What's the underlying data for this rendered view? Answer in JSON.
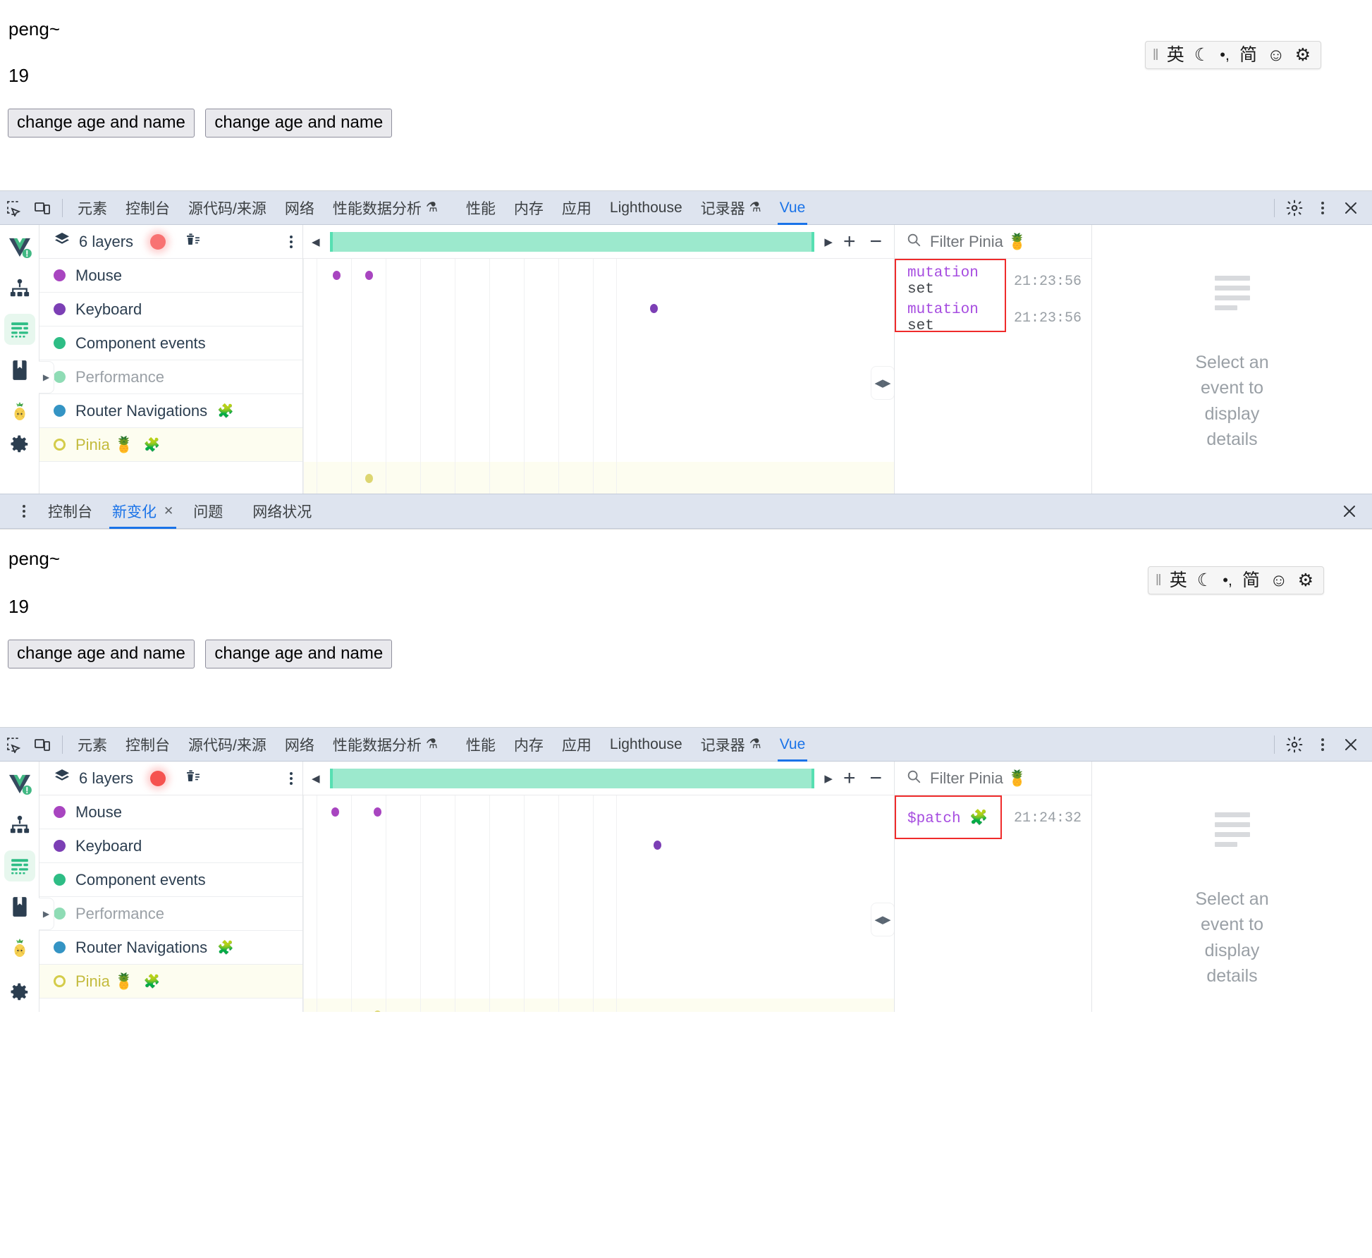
{
  "app": {
    "name_text": "peng~",
    "age_text": "19",
    "button1_label": "change age and name",
    "button2_label": "change age and name"
  },
  "ime_bar": {
    "grip": "ime-grip-icon",
    "items": [
      {
        "icon": "english-mode-icon",
        "glyph": "英"
      },
      {
        "icon": "moon-icon",
        "glyph": "☾"
      },
      {
        "icon": "punctuation-icon",
        "glyph": "•,"
      },
      {
        "icon": "simplified-chinese-icon",
        "glyph": "简"
      },
      {
        "icon": "emoji-icon",
        "glyph": "☺"
      },
      {
        "icon": "gear-icon",
        "glyph": "⚙"
      }
    ]
  },
  "devtools": {
    "left_icons": [
      {
        "name": "inspect-element-icon",
        "glyph": "⊹"
      },
      {
        "name": "device-toolbar-icon",
        "glyph": "▭"
      }
    ],
    "tabs": [
      {
        "label": "元素",
        "flask": false,
        "active": false
      },
      {
        "label": "控制台",
        "flask": false,
        "active": false
      },
      {
        "label": "源代码/来源",
        "flask": false,
        "active": false
      },
      {
        "label": "网络",
        "flask": false,
        "active": false
      },
      {
        "label": "性能数据分析",
        "flask": true,
        "active": false
      },
      {
        "label": "性能",
        "flask": false,
        "active": false
      },
      {
        "label": "内存",
        "flask": false,
        "active": false
      },
      {
        "label": "应用",
        "flask": false,
        "active": false
      },
      {
        "label": "Lighthouse",
        "flask": false,
        "active": false
      },
      {
        "label": "记录器",
        "flask": true,
        "active": false
      },
      {
        "label": "Vue",
        "flask": false,
        "active": true
      }
    ],
    "right_icons": [
      {
        "name": "settings-gear-icon",
        "glyph": "⚙"
      },
      {
        "name": "more-options-icon",
        "glyph": "⋮"
      },
      {
        "name": "close-devtools-icon",
        "glyph": "✕"
      }
    ],
    "flask_glyph": "⚗",
    "accent_color": "#1a73e8",
    "tabbar_bg": "#dee4ef"
  },
  "vue_panel": {
    "rail_items": [
      {
        "name": "vue-logo-icon",
        "active": false
      },
      {
        "name": "component-tree-icon",
        "active": false
      },
      {
        "name": "timeline-icon",
        "active": true
      },
      {
        "name": "docs-book-icon",
        "active": false
      },
      {
        "name": "pinia-pineapple-icon",
        "active": false
      }
    ],
    "rail_bottom": {
      "name": "settings-gear-icon"
    },
    "layers_header": {
      "layers_icon": "layers-icon",
      "layers_label": "6 layers",
      "record_button": "record-toggle-button",
      "clear_button": "clear-timeline-icon",
      "menu_button": "more-options-icon",
      "record_color": "#f87272"
    },
    "layers": [
      {
        "label": "Mouse",
        "color": "#a845c0",
        "hollow": false,
        "dim": false,
        "plugin": false
      },
      {
        "label": "Keyboard",
        "color": "#7c3fb5",
        "hollow": false,
        "dim": false,
        "plugin": false
      },
      {
        "label": "Component events",
        "color": "#2ebd85",
        "hollow": false,
        "dim": false,
        "plugin": false
      },
      {
        "label": "Performance",
        "color": "#8fdcb5",
        "hollow": false,
        "dim": true,
        "plugin": false
      },
      {
        "label": "Router Navigations",
        "color": "#3494c4",
        "hollow": false,
        "dim": false,
        "plugin": true
      },
      {
        "label": "Pinia 🍍",
        "color": "#d4cc4a",
        "hollow": true,
        "dim": false,
        "plugin": true
      }
    ],
    "timeline": {
      "scroll_left_icon": "scroll-left-icon",
      "scroll_right_icon": "scroll-right-icon",
      "zoom_in_label": "+",
      "zoom_out_label": "−",
      "selection_color": "#9ce9cd",
      "grid_count": 11,
      "handle_icon": "resize-handle-icon"
    },
    "search": {
      "icon": "search-icon",
      "placeholder": "Filter Pinia 🍍"
    },
    "detail_placeholder": {
      "icon": "empty-list-icon",
      "text": "Select an event to display details"
    }
  },
  "panel_one": {
    "events": [
      {
        "keyword": "mutation",
        "rest": " set",
        "time": "21:23:56"
      },
      {
        "keyword": "mutation",
        "rest": " set",
        "time": "21:23:56"
      }
    ],
    "annotation_color": "#ef2b2b"
  },
  "panel_two": {
    "events": [
      {
        "keyword": "$patch",
        "rest": " 🧩",
        "time": "21:24:32"
      }
    ],
    "annotation_color": "#ef2b2b"
  },
  "drawer": {
    "menu_icon": "more-options-icon",
    "tabs": [
      {
        "label": "控制台",
        "active": false,
        "closable": false
      },
      {
        "label": "新变化",
        "active": true,
        "closable": true
      },
      {
        "label": "问题",
        "active": false,
        "closable": false
      },
      {
        "label": "网络状况",
        "active": false,
        "closable": false
      }
    ],
    "close_icon": "close-drawer-icon",
    "close_glyph": "✕"
  }
}
